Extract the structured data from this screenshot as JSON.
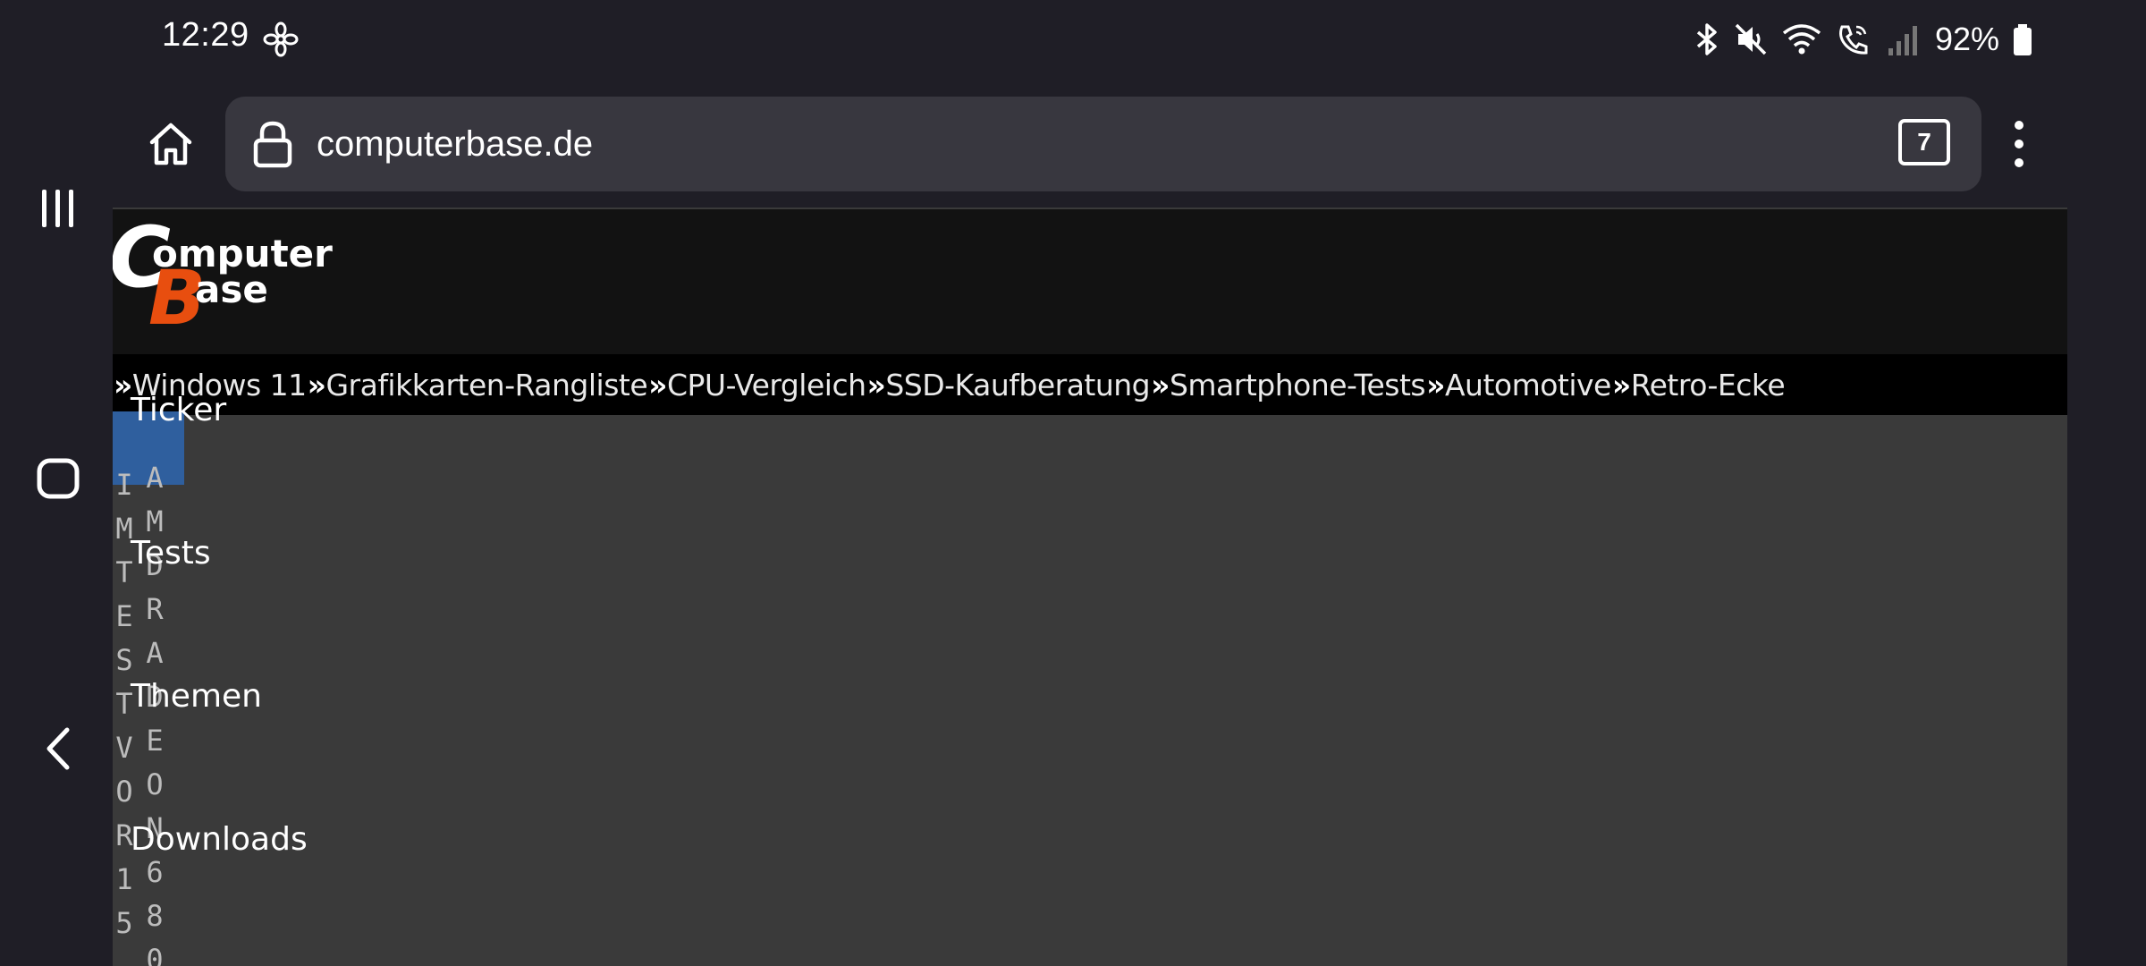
{
  "status_bar": {
    "time": "12:29",
    "battery": "92%",
    "icons": [
      "fan-icon",
      "bluetooth-icon",
      "mute-icon",
      "wifi-icon",
      "wifi-calling-icon",
      "signal-icon",
      "battery-icon"
    ]
  },
  "browser": {
    "url": "computerbase.de",
    "tab_count": "7"
  },
  "site": {
    "logo_text": "ComputerBase",
    "top_nav": [
      "Windows 11",
      "Grafikkarten-Rangliste",
      "CPU-Vergleich",
      "SSD-Kaufberatung",
      "Smartphone-Tests",
      "Automotive",
      "Retro-Ecke"
    ],
    "nav_separator": "»",
    "side_menu": [
      "Ticker",
      "Tests",
      "Themen",
      "Downloads"
    ],
    "vertical_text_col1": "IMTESTVOR15",
    "vertical_text_col2": "AMDRADEON680"
  },
  "colors": {
    "system_bg": "#1f1e26",
    "url_bar": "#38373f",
    "page_bg": "#3a3a3a",
    "header_bg": "#121212",
    "nav_bg": "#000000",
    "logo_accent": "#e84e0f",
    "highlight_blue": "#2f5f9e"
  }
}
